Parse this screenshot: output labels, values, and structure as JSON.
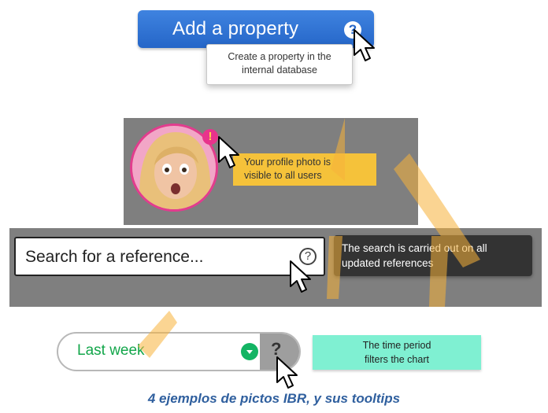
{
  "examples": {
    "add_property": {
      "button_label": "Add a property",
      "help_glyph": "?",
      "tooltip_line1": "Create a property in the",
      "tooltip_line2": "internal database",
      "button_color": "#2566c8"
    },
    "profile_photo": {
      "badge_glyph": "!",
      "tooltip_line1": "Your profile photo is",
      "tooltip_line2": "visible to all users",
      "badge_color": "#e8338c",
      "tooltip_color": "#f5c23a"
    },
    "search": {
      "placeholder": "Search for a reference...",
      "help_glyph": "?",
      "tooltip_line1": "The search is carried out on all",
      "tooltip_line2": "updated references"
    },
    "time_period": {
      "selected_value": "Last week",
      "help_glyph": "?",
      "tooltip_line1": "The time period",
      "tooltip_line2": "filters the chart",
      "accent_color": "#13b463",
      "tooltip_color": "#7ff0d2"
    }
  },
  "caption": "4 ejemplos de pictos IBR, y sus tooltips",
  "icons": [
    "help-icon",
    "warning-badge-icon",
    "mouse-cursor-icon",
    "chevron-down-icon"
  ]
}
